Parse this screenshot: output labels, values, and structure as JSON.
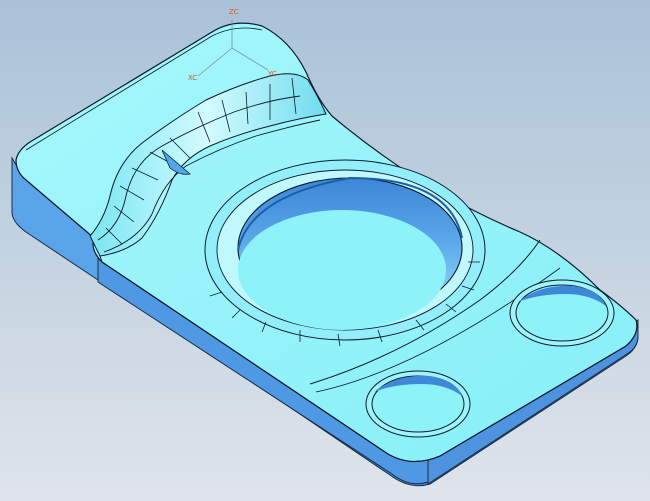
{
  "viewport": {
    "background_top": "#a9c2d8",
    "background_bottom": "#dfe4ea"
  },
  "part": {
    "top_face_color": "#8df3f9",
    "side_face_color": "#5aa0e8",
    "edge_color": "#0d1a2a"
  },
  "triad": {
    "z_label": "ZC",
    "x_label": "XC",
    "y_label": "YC",
    "label_color": "#e0561a"
  }
}
